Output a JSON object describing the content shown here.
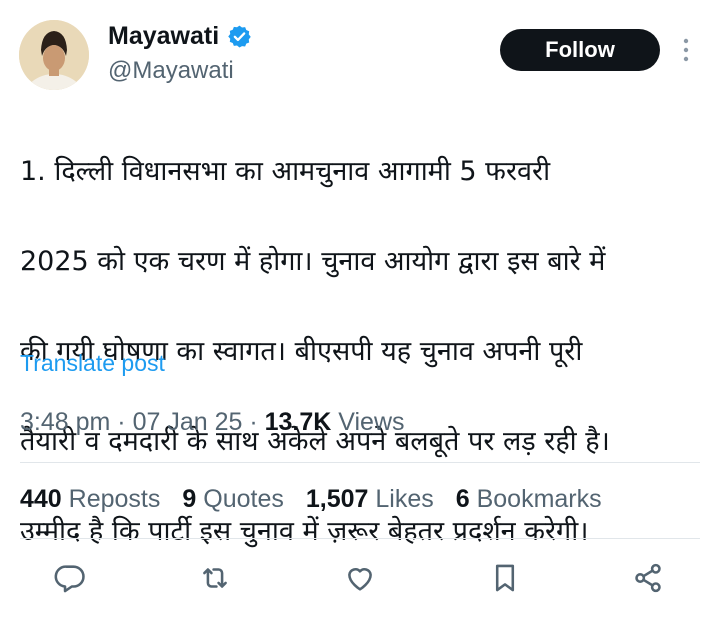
{
  "author": {
    "name": "Mayawati",
    "handle": "@Mayawati",
    "verified": true,
    "avatar_icon": "avatar"
  },
  "follow_label": "Follow",
  "tweet": {
    "lines": [
      "1. दिल्ली विधानसभा का आमचुनाव आगामी 5 फरवरी",
      "2025 को एक चरण में होगा। चुनाव आयोग द्वारा इस बारे में",
      "की गयी घोषणा का स्वागत। बीएसपी यह चुनाव अपनी पूरी",
      "तैयारी व दमदारी के साथ अकेले अपने बलबूते पर लड़ रही है।",
      "उम्मीद है कि पार्टी इस चुनाव में ज़रूर बेहतर प्रदर्शन करेगी।"
    ]
  },
  "translate_label": "Translate post",
  "meta": {
    "time": "3:48 pm",
    "sep1": " · ",
    "date": "07 Jan 25",
    "sep2": " · ",
    "views_count": "13.7K",
    "views_label": " Views"
  },
  "stats": [
    {
      "count": "440",
      "label": " Reposts"
    },
    {
      "count": "9",
      "label": " Quotes"
    },
    {
      "count": "1,507",
      "label": " Likes"
    },
    {
      "count": "6",
      "label": " Bookmarks"
    }
  ],
  "actions": [
    "reply-icon",
    "repost-icon",
    "like-icon",
    "bookmark-icon",
    "share-icon"
  ],
  "colors": {
    "accent": "#1d9bf0",
    "text": "#0f1419",
    "secondary": "#536471",
    "follow_bg": "#0f1419"
  }
}
